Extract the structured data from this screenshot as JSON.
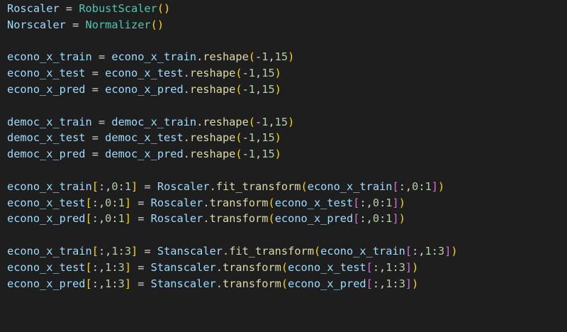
{
  "editor": {
    "lines": [
      [
        [
          "var",
          "Roscaler"
        ],
        [
          "op",
          " = "
        ],
        [
          "cls",
          "RobustScaler"
        ],
        [
          "p1",
          "()"
        ]
      ],
      [
        [
          "var",
          "Norscaler"
        ],
        [
          "op",
          " = "
        ],
        [
          "cls",
          "Normalizer"
        ],
        [
          "p1",
          "()"
        ]
      ],
      [],
      [
        [
          "var",
          "econo_x_train"
        ],
        [
          "op",
          " = "
        ],
        [
          "var",
          "econo_x_train"
        ],
        [
          "op",
          "."
        ],
        [
          "fn",
          "reshape"
        ],
        [
          "p1",
          "("
        ],
        [
          "op",
          "-"
        ],
        [
          "num",
          "1"
        ],
        [
          "op",
          ","
        ],
        [
          "num",
          "15"
        ],
        [
          "p1",
          ")"
        ]
      ],
      [
        [
          "var",
          "econo_x_test"
        ],
        [
          "op",
          " = "
        ],
        [
          "var",
          "econo_x_test"
        ],
        [
          "op",
          "."
        ],
        [
          "fn",
          "reshape"
        ],
        [
          "p1",
          "("
        ],
        [
          "op",
          "-"
        ],
        [
          "num",
          "1"
        ],
        [
          "op",
          ","
        ],
        [
          "num",
          "15"
        ],
        [
          "p1",
          ")"
        ]
      ],
      [
        [
          "var",
          "econo_x_pred"
        ],
        [
          "op",
          " = "
        ],
        [
          "var",
          "econo_x_pred"
        ],
        [
          "op",
          "."
        ],
        [
          "fn",
          "reshape"
        ],
        [
          "p1",
          "("
        ],
        [
          "op",
          "-"
        ],
        [
          "num",
          "1"
        ],
        [
          "op",
          ","
        ],
        [
          "num",
          "15"
        ],
        [
          "p1",
          ")"
        ]
      ],
      [],
      [
        [
          "var",
          "democ_x_train"
        ],
        [
          "op",
          " = "
        ],
        [
          "var",
          "democ_x_train"
        ],
        [
          "op",
          "."
        ],
        [
          "fn",
          "reshape"
        ],
        [
          "p1",
          "("
        ],
        [
          "op",
          "-"
        ],
        [
          "num",
          "1"
        ],
        [
          "op",
          ","
        ],
        [
          "num",
          "15"
        ],
        [
          "p1",
          ")"
        ]
      ],
      [
        [
          "var",
          "democ_x_test"
        ],
        [
          "op",
          " = "
        ],
        [
          "var",
          "democ_x_test"
        ],
        [
          "op",
          "."
        ],
        [
          "fn",
          "reshape"
        ],
        [
          "p1",
          "("
        ],
        [
          "op",
          "-"
        ],
        [
          "num",
          "1"
        ],
        [
          "op",
          ","
        ],
        [
          "num",
          "15"
        ],
        [
          "p1",
          ")"
        ]
      ],
      [
        [
          "var",
          "democ_x_pred"
        ],
        [
          "op",
          " = "
        ],
        [
          "var",
          "democ_x_pred"
        ],
        [
          "op",
          "."
        ],
        [
          "fn",
          "reshape"
        ],
        [
          "p1",
          "("
        ],
        [
          "op",
          "-"
        ],
        [
          "num",
          "1"
        ],
        [
          "op",
          ","
        ],
        [
          "num",
          "15"
        ],
        [
          "p1",
          ")"
        ]
      ],
      [],
      [
        [
          "var",
          "econo_x_train"
        ],
        [
          "p1",
          "["
        ],
        [
          "op",
          ":,"
        ],
        [
          "num",
          "0"
        ],
        [
          "op",
          ":"
        ],
        [
          "num",
          "1"
        ],
        [
          "p1",
          "]"
        ],
        [
          "op",
          " = "
        ],
        [
          "var",
          "Roscaler"
        ],
        [
          "op",
          "."
        ],
        [
          "fn",
          "fit_transform"
        ],
        [
          "p1",
          "("
        ],
        [
          "var",
          "econo_x_train"
        ],
        [
          "p2",
          "["
        ],
        [
          "op",
          ":,"
        ],
        [
          "num",
          "0"
        ],
        [
          "op",
          ":"
        ],
        [
          "num",
          "1"
        ],
        [
          "p2",
          "]"
        ],
        [
          "p1",
          ")"
        ]
      ],
      [
        [
          "var",
          "econo_x_test"
        ],
        [
          "p1",
          "["
        ],
        [
          "op",
          ":,"
        ],
        [
          "num",
          "0"
        ],
        [
          "op",
          ":"
        ],
        [
          "num",
          "1"
        ],
        [
          "p1",
          "]"
        ],
        [
          "op",
          " = "
        ],
        [
          "var",
          "Roscaler"
        ],
        [
          "op",
          "."
        ],
        [
          "fn",
          "transform"
        ],
        [
          "p1",
          "("
        ],
        [
          "var",
          "econo_x_test"
        ],
        [
          "p2",
          "["
        ],
        [
          "op",
          ":,"
        ],
        [
          "num",
          "0"
        ],
        [
          "op",
          ":"
        ],
        [
          "num",
          "1"
        ],
        [
          "p2",
          "]"
        ],
        [
          "p1",
          ")"
        ]
      ],
      [
        [
          "var",
          "econo_x_pred"
        ],
        [
          "p1",
          "["
        ],
        [
          "op",
          ":,"
        ],
        [
          "num",
          "0"
        ],
        [
          "op",
          ":"
        ],
        [
          "num",
          "1"
        ],
        [
          "p1",
          "]"
        ],
        [
          "op",
          " = "
        ],
        [
          "var",
          "Roscaler"
        ],
        [
          "op",
          "."
        ],
        [
          "fn",
          "transform"
        ],
        [
          "p1",
          "("
        ],
        [
          "var",
          "econo_x_pred"
        ],
        [
          "p2",
          "["
        ],
        [
          "op",
          ":,"
        ],
        [
          "num",
          "0"
        ],
        [
          "op",
          ":"
        ],
        [
          "num",
          "1"
        ],
        [
          "p2",
          "]"
        ],
        [
          "p1",
          ")"
        ]
      ],
      [],
      [
        [
          "var",
          "econo_x_train"
        ],
        [
          "p1",
          "["
        ],
        [
          "op",
          ":,"
        ],
        [
          "num",
          "1"
        ],
        [
          "op",
          ":"
        ],
        [
          "num",
          "3"
        ],
        [
          "p1",
          "]"
        ],
        [
          "op",
          " = "
        ],
        [
          "var",
          "Stanscaler"
        ],
        [
          "op",
          "."
        ],
        [
          "fn",
          "fit_transform"
        ],
        [
          "p1",
          "("
        ],
        [
          "var",
          "econo_x_train"
        ],
        [
          "p2",
          "["
        ],
        [
          "op",
          ":,"
        ],
        [
          "num",
          "1"
        ],
        [
          "op",
          ":"
        ],
        [
          "num",
          "3"
        ],
        [
          "p2",
          "]"
        ],
        [
          "p1",
          ")"
        ]
      ],
      [
        [
          "var",
          "econo_x_test"
        ],
        [
          "p1",
          "["
        ],
        [
          "op",
          ":,"
        ],
        [
          "num",
          "1"
        ],
        [
          "op",
          ":"
        ],
        [
          "num",
          "3"
        ],
        [
          "p1",
          "]"
        ],
        [
          "op",
          " = "
        ],
        [
          "var",
          "Stanscaler"
        ],
        [
          "op",
          "."
        ],
        [
          "fn",
          "transform"
        ],
        [
          "p1",
          "("
        ],
        [
          "var",
          "econo_x_test"
        ],
        [
          "p2",
          "["
        ],
        [
          "op",
          ":,"
        ],
        [
          "num",
          "1"
        ],
        [
          "op",
          ":"
        ],
        [
          "num",
          "3"
        ],
        [
          "p2",
          "]"
        ],
        [
          "p1",
          ")"
        ]
      ],
      [
        [
          "var",
          "econo_x_pred"
        ],
        [
          "p1",
          "["
        ],
        [
          "op",
          ":,"
        ],
        [
          "num",
          "1"
        ],
        [
          "op",
          ":"
        ],
        [
          "num",
          "3"
        ],
        [
          "p1",
          "]"
        ],
        [
          "op",
          " = "
        ],
        [
          "var",
          "Stanscaler"
        ],
        [
          "op",
          "."
        ],
        [
          "fn",
          "transform"
        ],
        [
          "p1",
          "("
        ],
        [
          "var",
          "econo_x_pred"
        ],
        [
          "p2",
          "["
        ],
        [
          "op",
          ":,"
        ],
        [
          "num",
          "1"
        ],
        [
          "op",
          ":"
        ],
        [
          "num",
          "3"
        ],
        [
          "p2",
          "]"
        ],
        [
          "p1",
          ")"
        ]
      ]
    ]
  },
  "colors": {
    "background": "#1e1e1e",
    "variable": "#9cdcfe",
    "class": "#4ec9b0",
    "function": "#dcdcaa",
    "operator": "#d4d4d4",
    "number": "#b5cea8",
    "bracket_level1": "#ffd700",
    "bracket_level2": "#da70d6"
  }
}
